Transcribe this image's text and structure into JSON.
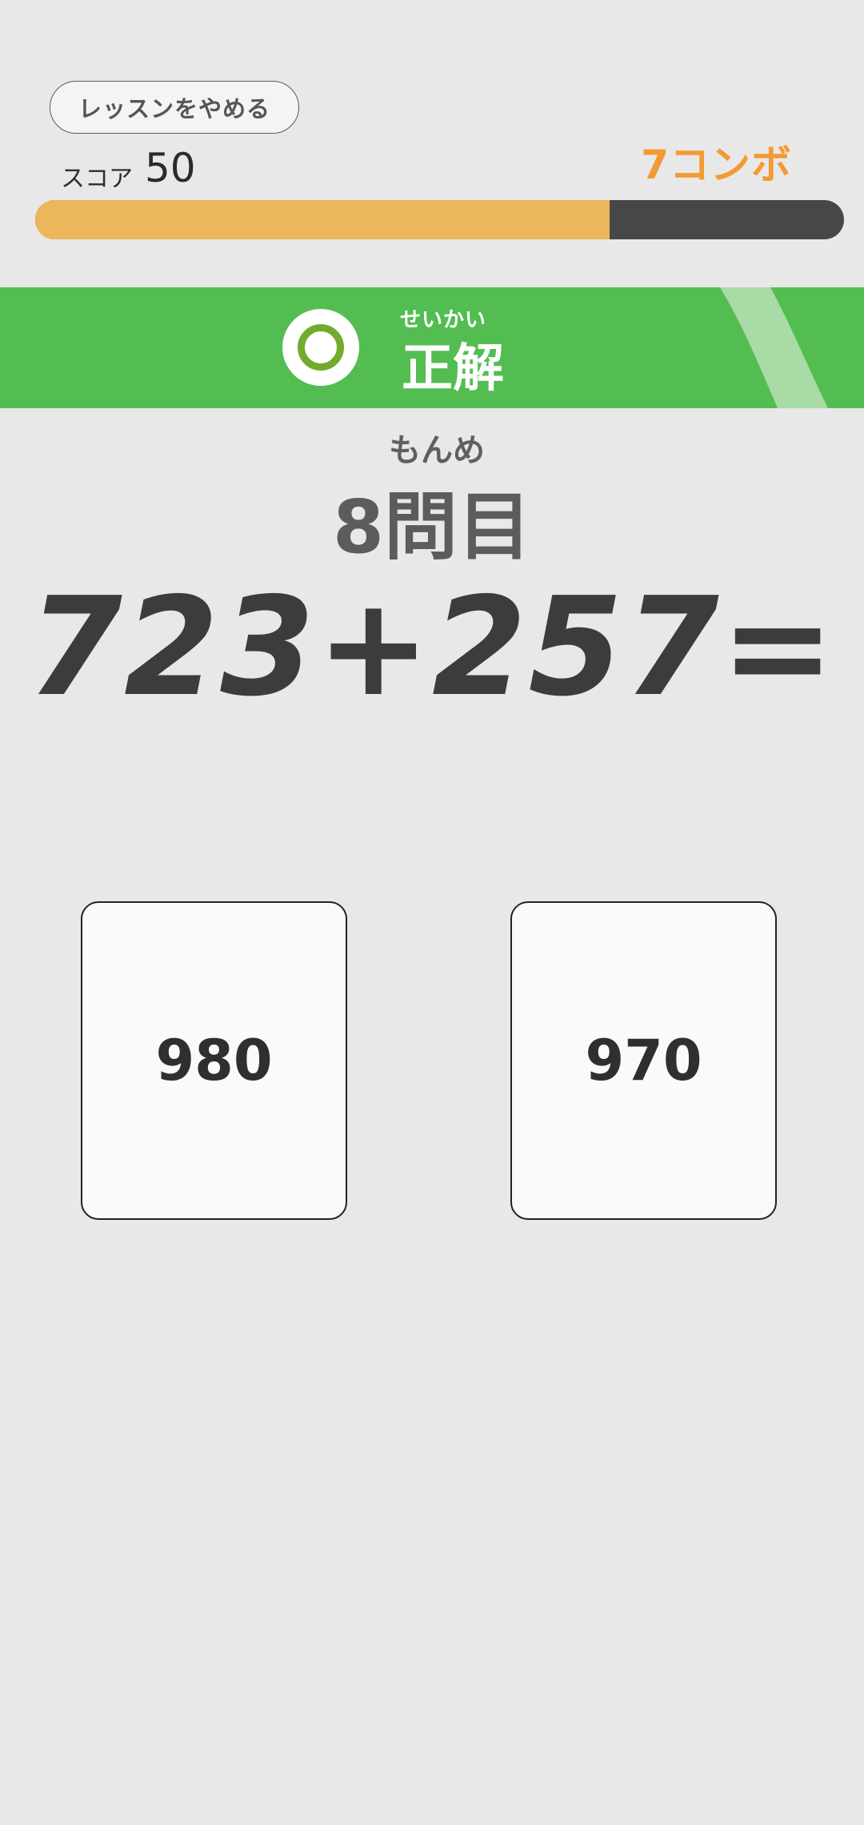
{
  "header": {
    "quit_label": "レッスンをやめる",
    "score_label": "スコア",
    "score_value": "50",
    "combo_text": "7コンボ",
    "progress_fraction": 0.71
  },
  "result": {
    "ruby": "せいかい",
    "text": "正解",
    "mark_icon": "circle-correct-icon"
  },
  "question": {
    "ruby": "もんめ",
    "number_text": "8問目",
    "equation": "723+257="
  },
  "answers": [
    {
      "label": "980"
    },
    {
      "label": "970"
    }
  ],
  "colors": {
    "background": "#e8e8e8",
    "banner_green": "#53bd52",
    "combo_orange": "#f39a32",
    "progress_fill": "#ecb75a",
    "progress_track": "#474747",
    "ring_green": "#73ab2e"
  }
}
